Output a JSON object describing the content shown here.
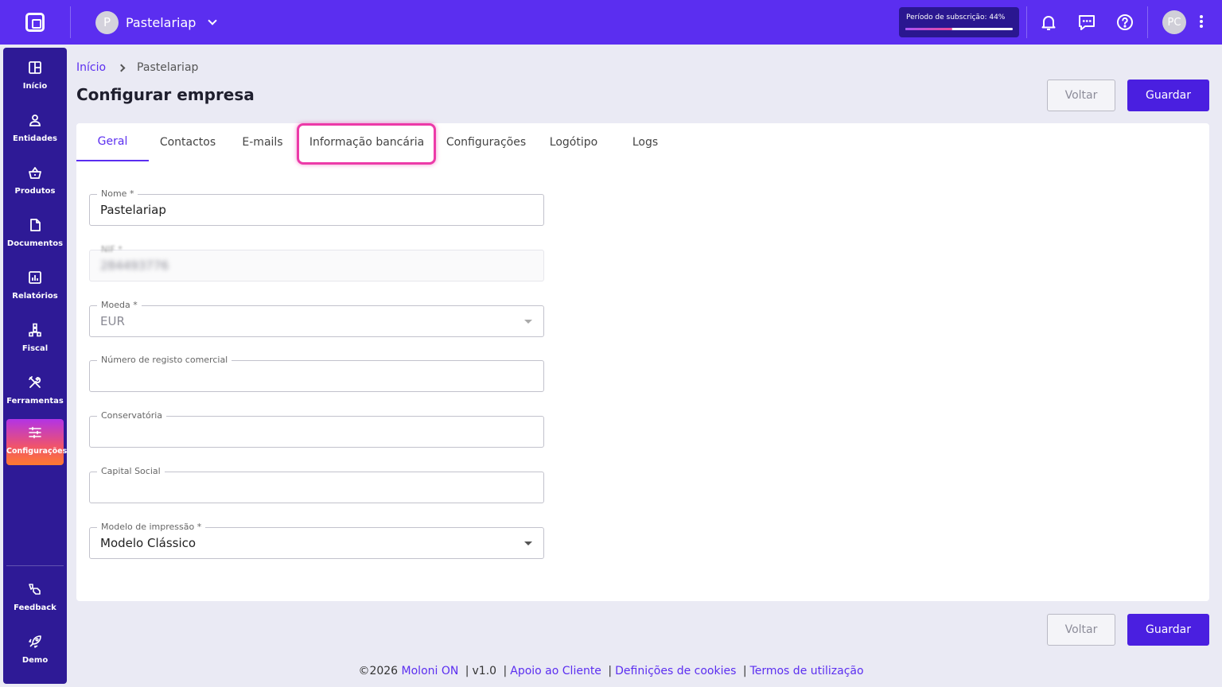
{
  "header": {
    "company_initial": "P",
    "company_name": "Pastelariap",
    "subscription_label": "Período de subscrição: 44%",
    "subscription_progress": 0.44,
    "user_initials": "PC"
  },
  "sidebar": {
    "items": [
      {
        "label": "Início",
        "icon": "grid-icon"
      },
      {
        "label": "Entidades",
        "icon": "person-icon"
      },
      {
        "label": "Produtos",
        "icon": "basket-icon"
      },
      {
        "label": "Documentos",
        "icon": "document-icon"
      },
      {
        "label": "Relatórios",
        "icon": "chart-icon"
      },
      {
        "label": "Fiscal",
        "icon": "network-icon"
      },
      {
        "label": "Ferramentas",
        "icon": "tools-icon"
      },
      {
        "label": "Configurações",
        "icon": "sliders-icon",
        "active": true
      }
    ],
    "bottom_items": [
      {
        "label": "Feedback",
        "icon": "feedback-icon"
      },
      {
        "label": "Demo",
        "icon": "rocket-icon"
      }
    ]
  },
  "breadcrumb": {
    "home": "Início",
    "current": "Pastelariap"
  },
  "page": {
    "title": "Configurar empresa",
    "back_label": "Voltar",
    "save_label": "Guardar"
  },
  "tabs": [
    {
      "label": "Geral",
      "active": true
    },
    {
      "label": "Contactos"
    },
    {
      "label": "E-mails"
    },
    {
      "label": "Informação bancária",
      "highlighted": true
    },
    {
      "label": "Configurações"
    },
    {
      "label": "Logótipo"
    },
    {
      "label": "Logs"
    }
  ],
  "form": {
    "nome": {
      "label": "Nome *",
      "value": "Pastelariap"
    },
    "nif": {
      "label": "NIF *",
      "value": "284493776"
    },
    "moeda": {
      "label": "Moeda *",
      "value": "EUR"
    },
    "registo": {
      "label": "Número de registo comercial",
      "value": ""
    },
    "conservatoria": {
      "label": "Conservatória",
      "value": ""
    },
    "capital": {
      "label": "Capital Social",
      "value": ""
    },
    "modelo": {
      "label": "Modelo de impressão *",
      "value": "Modelo Clássico"
    }
  },
  "footer": {
    "copyright": "©2026",
    "brand": "Moloni ON",
    "version": "v1.0",
    "support": "Apoio ao Cliente",
    "cookies": "Definições de cookies",
    "terms": "Termos de utilização",
    "separator": "|"
  },
  "colors": {
    "primary": "#5b2ef0",
    "sidebar": "#2e1a96",
    "highlight": "#ec3aa8"
  }
}
